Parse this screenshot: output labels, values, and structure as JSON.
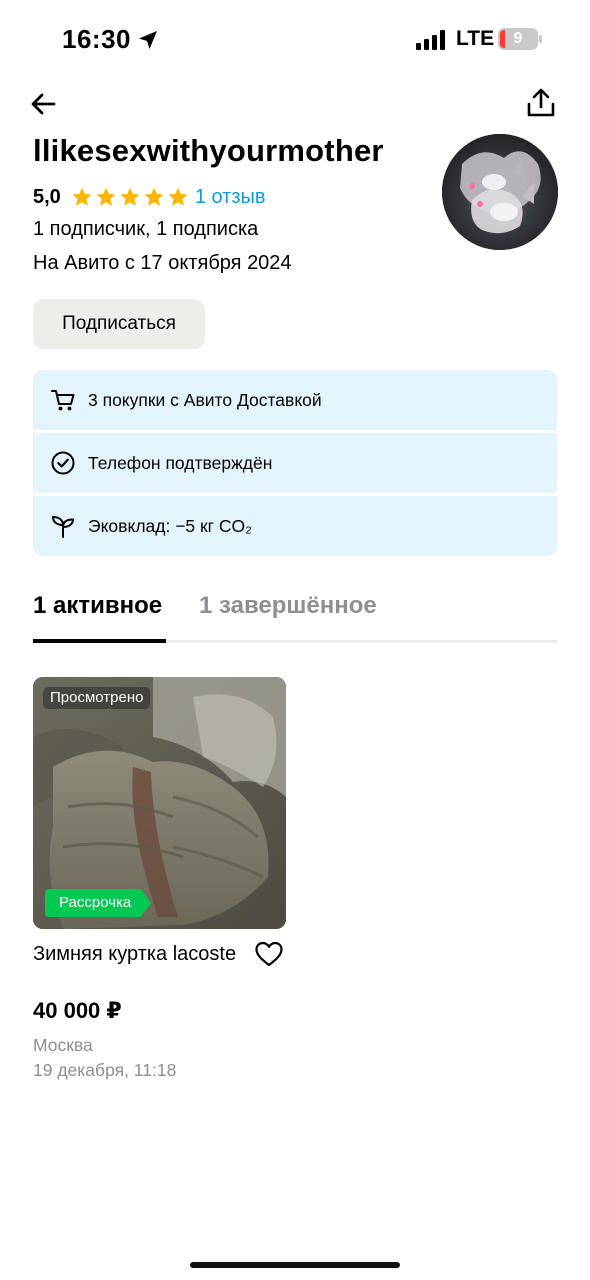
{
  "status_bar": {
    "time": "16:30",
    "network": "LTE",
    "battery": "9"
  },
  "profile": {
    "name": "llikesexwithyourmother",
    "rating": "5,0",
    "stars": 5,
    "reviews_link": "1 отзыв",
    "subscribers": "1 подписчик, 1 подписка",
    "since": "На Авито с 17 октября 2024",
    "subscribe_button": "Подписаться"
  },
  "info_items": [
    {
      "icon": "cart-icon",
      "text": "3 покупки с Авито Доставкой"
    },
    {
      "icon": "check-circle-icon",
      "text": "Телефон подтверждён"
    },
    {
      "icon": "sprout-icon",
      "text": "Эковклад: −5 кг CO₂"
    }
  ],
  "tabs": [
    {
      "label": "1 активное",
      "active": true
    },
    {
      "label": "1 завершённое",
      "active": false
    }
  ],
  "listing": {
    "viewed_badge": "Просмотрено",
    "installment_badge": "Рассрочка",
    "title": "Зимняя куртка lacoste",
    "price": "40 000 ₽",
    "city": "Москва",
    "date": "19 декабря, 11:18"
  },
  "colors": {
    "link": "#0a9ae0",
    "star": "#ffb400",
    "info_bg": "#e3f4fd",
    "button_bg": "#efede9",
    "installment_green": "#00c853",
    "muted_text": "#8e8e93"
  }
}
